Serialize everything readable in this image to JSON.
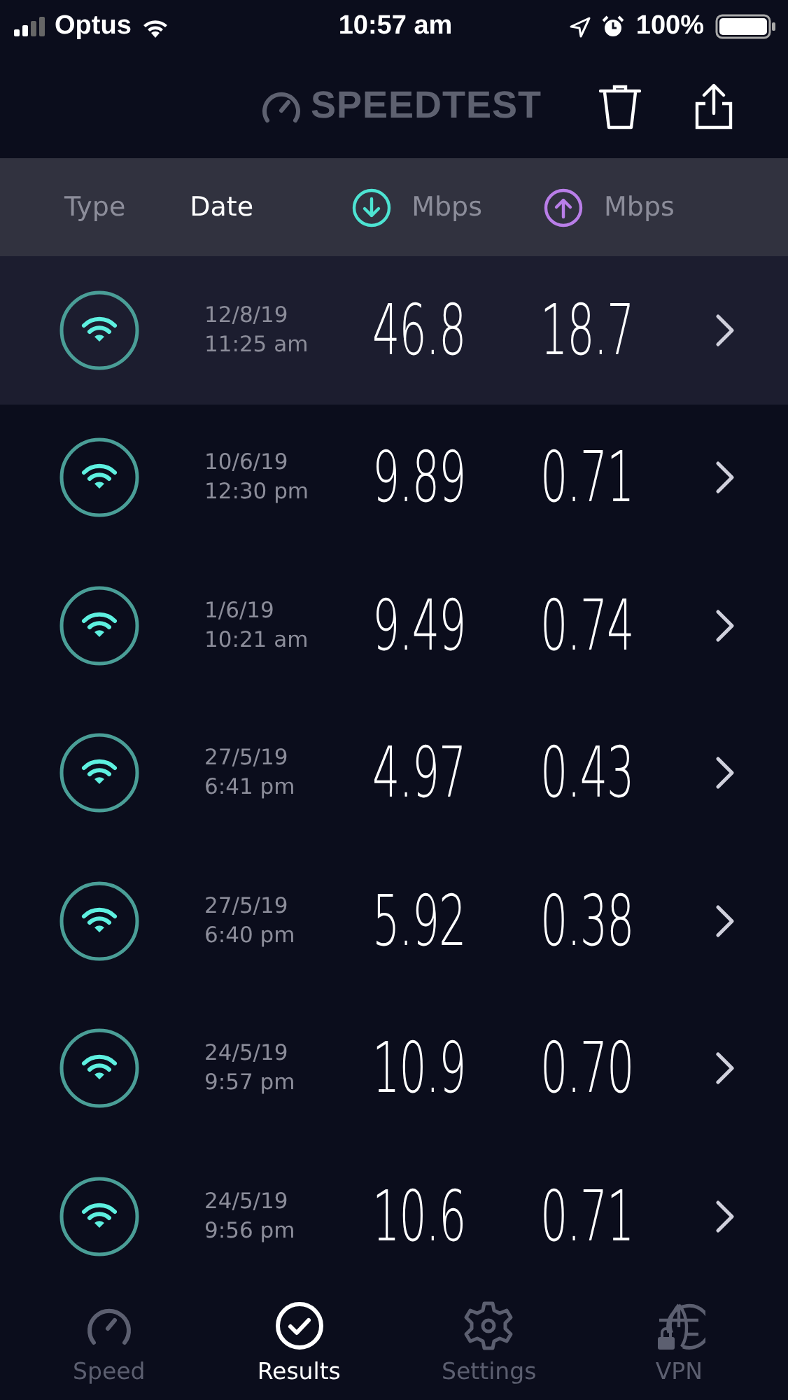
{
  "status_bar": {
    "carrier": "Optus",
    "time": "10:57 am",
    "battery": "100%"
  },
  "header": {
    "logo": "SPEEDTEST"
  },
  "columns": [
    {
      "label": "Type",
      "kind": "text",
      "selected": false
    },
    {
      "label": "Date",
      "kind": "text",
      "selected": true
    },
    {
      "label": "Mbps",
      "kind": "download",
      "selected": false
    },
    {
      "label": "Mbps",
      "kind": "upload",
      "selected": false
    }
  ],
  "rows": [
    {
      "date": "12/8/19",
      "time": "11:25 am",
      "download": "46.8",
      "upload": "18.7",
      "selected": true
    },
    {
      "date": "10/6/19",
      "time": "12:30 pm",
      "download": "9.89",
      "upload": "0.71",
      "selected": false
    },
    {
      "date": "1/6/19",
      "time": "10:21 am",
      "download": "9.49",
      "upload": "0.74",
      "selected": false
    },
    {
      "date": "27/5/19",
      "time": "6:41 pm",
      "download": "4.97",
      "upload": "0.43",
      "selected": false
    },
    {
      "date": "27/5/19",
      "time": "6:40 pm",
      "download": "5.92",
      "upload": "0.38",
      "selected": false
    },
    {
      "date": "24/5/19",
      "time": "9:57 pm",
      "download": "10.9",
      "upload": "0.70",
      "selected": false
    },
    {
      "date": "24/5/19",
      "time": "9:56 pm",
      "download": "10.6",
      "upload": "0.71",
      "selected": false
    }
  ],
  "tabs": [
    {
      "label": "Speed",
      "kind": "speed",
      "selected": false
    },
    {
      "label": "Results",
      "kind": "results",
      "selected": true
    },
    {
      "label": "Settings",
      "kind": "settings",
      "selected": false
    },
    {
      "label": "VPN",
      "kind": "vpn",
      "selected": false
    }
  ]
}
